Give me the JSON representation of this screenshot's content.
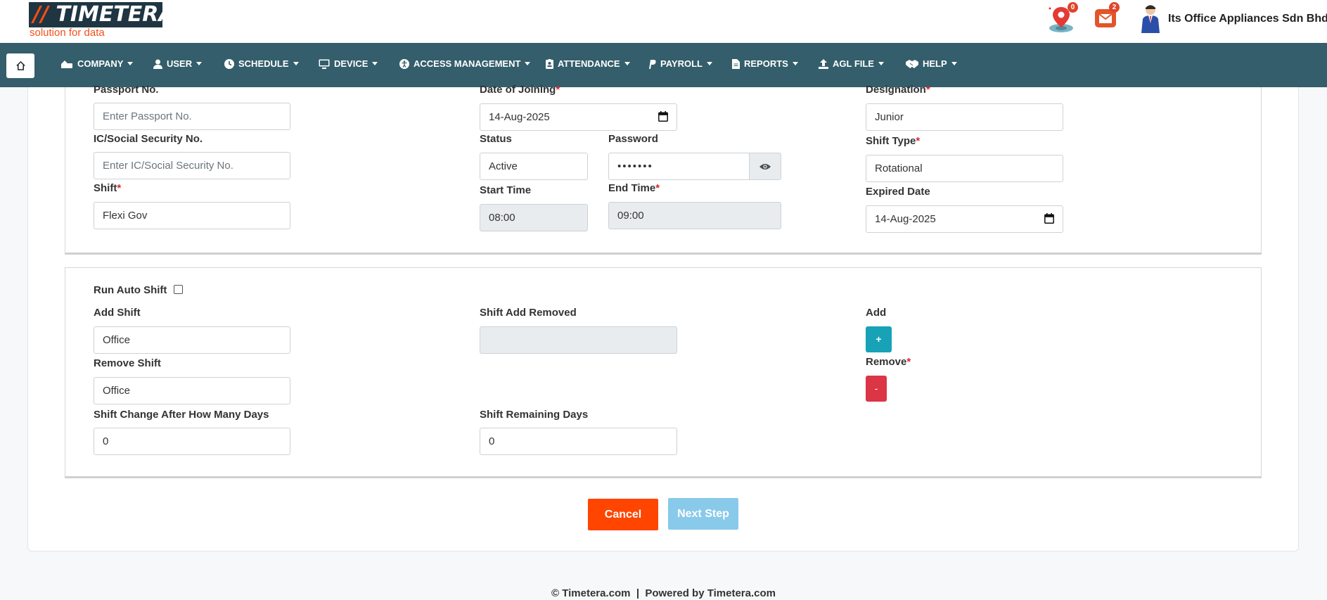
{
  "brand": {
    "name": "TIMETERA",
    "slashes": "//",
    "tagline": "solution for data"
  },
  "header": {
    "location_badge": "0",
    "mail_badge": "2",
    "company_name": "Its Office Appliances Sdn Bhd"
  },
  "nav": {
    "items": [
      {
        "label": "COMPANY",
        "icon": "company-icon"
      },
      {
        "label": "USER",
        "icon": "user-icon"
      },
      {
        "label": "SCHEDULE",
        "icon": "clock-icon"
      },
      {
        "label": "DEVICE",
        "icon": "monitor-icon"
      },
      {
        "label": "ACCESS MANAGEMENT",
        "icon": "accessibility-icon"
      },
      {
        "label": "ATTENDANCE",
        "icon": "badge-icon"
      },
      {
        "label": "PAYROLL",
        "icon": "paypal-icon"
      },
      {
        "label": "REPORTS",
        "icon": "file-icon"
      },
      {
        "label": "AGL FILE",
        "icon": "upload-icon"
      },
      {
        "label": "HELP",
        "icon": "handshake-icon"
      }
    ]
  },
  "form": {
    "passport_label": "Passport No.",
    "passport_placeholder": "Enter Passport No.",
    "ic_label": "IC/Social Security No.",
    "ic_placeholder": "Enter IC/Social Security No.",
    "shift_label": "Shift",
    "shift_value": "Flexi Gov",
    "doj_label": "Date of Joining",
    "doj_value": "14-Aug-2025",
    "status_label": "Status",
    "status_value": "Active",
    "password_label": "Password",
    "password_value": "•••••••",
    "start_time_label": "Start Time",
    "start_time_value": "08:00",
    "end_time_label": "End Time",
    "end_time_value": "09:00",
    "designation_label": "Designation",
    "designation_value": "Junior",
    "shift_type_label": "Shift Type",
    "shift_type_value": "Rotational",
    "expired_label": "Expired Date",
    "expired_value": "14-Aug-2025",
    "required_mark": "*"
  },
  "auto_shift": {
    "run_label": "Run Auto Shift",
    "run_checked": false,
    "add_shift_label": "Add Shift",
    "add_shift_value": "Office",
    "shift_add_removed_label": "Shift Add Removed",
    "shift_add_removed_value": "",
    "add_label": "Add",
    "add_button": "+",
    "remove_label": "Remove",
    "remove_button": "-",
    "remove_shift_label": "Remove Shift",
    "remove_shift_value": "Office",
    "change_days_label": "Shift Change After How Many Days",
    "change_days_value": "0",
    "remaining_days_label": "Shift Remaining Days",
    "remaining_days_value": "0"
  },
  "actions": {
    "cancel": "Cancel",
    "next": "Next Step"
  },
  "footer": {
    "text": "© Timetera.com  |  Powered by Timetera.com"
  },
  "colors": {
    "navbar": "#345e6b",
    "accent": "#ff4500",
    "add": "#17a2b8",
    "remove": "#dc3545",
    "next_disabled": "#89c9ea"
  }
}
